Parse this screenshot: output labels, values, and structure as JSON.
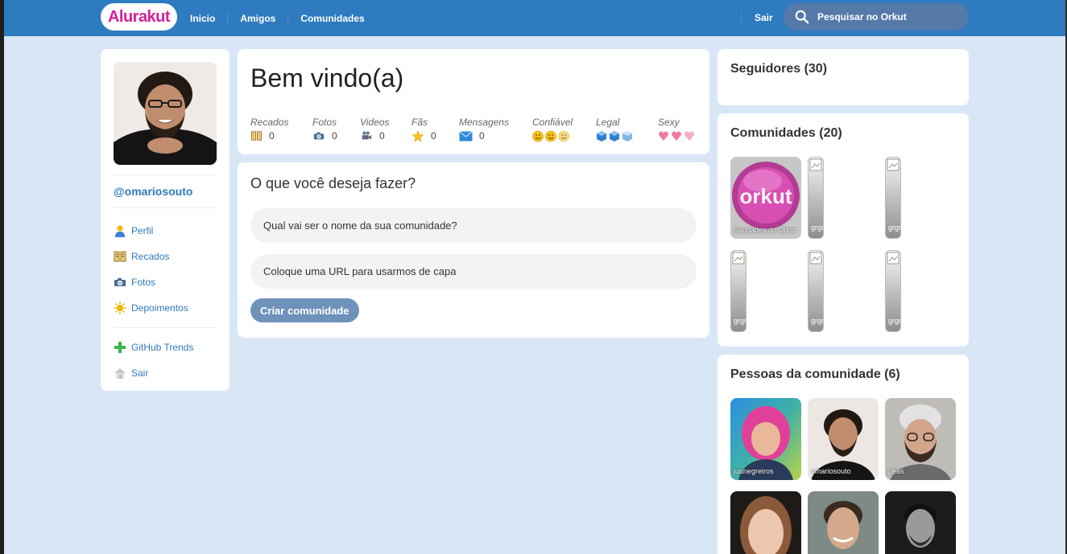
{
  "header": {
    "logo": "Alurakut",
    "nav": [
      "Inicio",
      "Amigos",
      "Comunidades"
    ],
    "logout": "Sair",
    "search_placeholder": "Pesquisar no Orkut"
  },
  "profile": {
    "username": "@omariosouto",
    "menu": [
      {
        "label": "Perfil",
        "icon": "user-icon"
      },
      {
        "label": "Recados",
        "icon": "book-icon"
      },
      {
        "label": "Fotos",
        "icon": "camera-icon"
      },
      {
        "label": "Depoimentos",
        "icon": "sun-icon"
      }
    ],
    "menu2": [
      {
        "label": "GitHub Trends",
        "icon": "plus-icon"
      },
      {
        "label": "Sair",
        "icon": "house-icon"
      }
    ]
  },
  "welcome": {
    "title": "Bem vindo(a)",
    "stats": [
      {
        "label": "Recados",
        "value": "0",
        "icon": "book-icon"
      },
      {
        "label": "Fotos",
        "value": "0",
        "icon": "camera-icon"
      },
      {
        "label": "Videos",
        "value": "0",
        "icon": "video-camera-icon"
      },
      {
        "label": "Fãs",
        "value": "0",
        "icon": "star-icon"
      },
      {
        "label": "Mensagens",
        "value": "0",
        "icon": "envelope-icon"
      }
    ],
    "ratings": [
      {
        "label": "Confiável",
        "icon": "smiley-icon",
        "count": 3
      },
      {
        "label": "Legal",
        "icon": "cube-icon",
        "count": 3
      },
      {
        "label": "Sexy",
        "icon": "heart-icon",
        "count": 3
      }
    ]
  },
  "form": {
    "title": "O que você deseja fazer?",
    "name_placeholder": "Qual vai ser o nome da sua comunidade?",
    "url_placeholder": "Coloque uma URL para usarmos de capa",
    "submit": "Criar comunidade"
  },
  "followers": {
    "title": "Seguidores (30)"
  },
  "communities": {
    "title": "Comunidades (20)",
    "items": [
      "Saudades do Orkut",
      "grgr",
      "grgr",
      "grgr",
      "grgr",
      "grgr"
    ]
  },
  "people": {
    "title": "Pessoas da comunidade (6)",
    "items": [
      "juunegreiros",
      "omariosouto",
      "peas",
      "",
      "",
      ""
    ]
  },
  "colors": {
    "header": "#2e7bbf",
    "background": "#d9e6f6",
    "link": "#2e7bbf",
    "button": "#6f92bb"
  }
}
